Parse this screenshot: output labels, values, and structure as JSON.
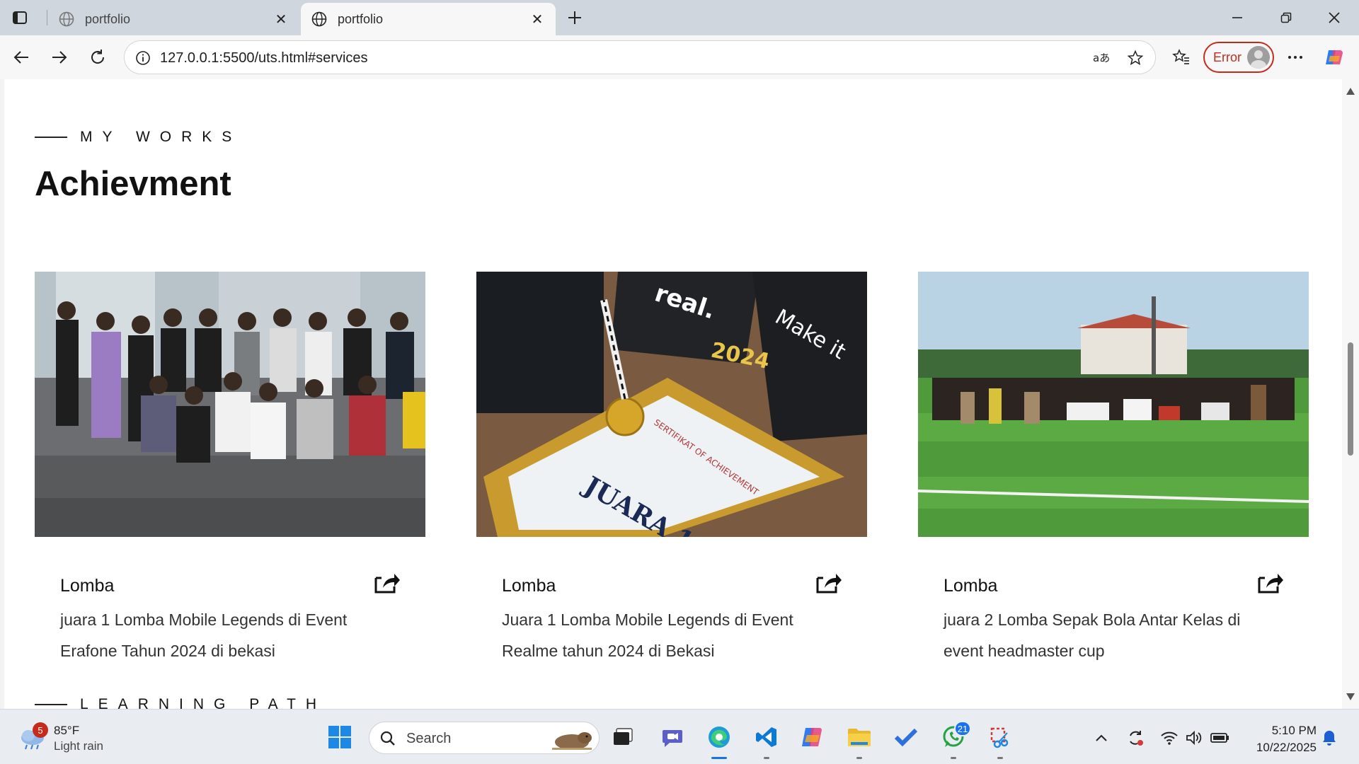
{
  "browser": {
    "tabs": [
      {
        "title": "portfolio",
        "active": false
      },
      {
        "title": "portfolio",
        "active": true
      }
    ],
    "address": "127.0.0.1:5500/uts.html#services",
    "profile_status": "Error"
  },
  "page": {
    "section_label": "MY WORKS",
    "title": "Achievment",
    "cards": [
      {
        "category": "Lomba",
        "description": "juara 1 Lomba Mobile Legends di Event Erafone Tahun 2024 di bekasi"
      },
      {
        "category": "Lomba",
        "description": "Juara 1 Lomba Mobile Legends di Event Realme tahun 2024 di Bekasi"
      },
      {
        "category": "Lomba",
        "description": "juara 2 Lomba Sepak Bola Antar Kelas di event headmaster cup"
      }
    ],
    "next_section_label": "LEARNING PATH"
  },
  "taskbar": {
    "weather": {
      "temp": "85°F",
      "condition": "Light rain",
      "alerts": "5"
    },
    "search_placeholder": "Search",
    "whatsapp_badge": "21",
    "time": "5:10 PM",
    "date": "10/22/2025"
  },
  "colors": {
    "accent": "#1a73e8",
    "error": "#c42b1c"
  }
}
